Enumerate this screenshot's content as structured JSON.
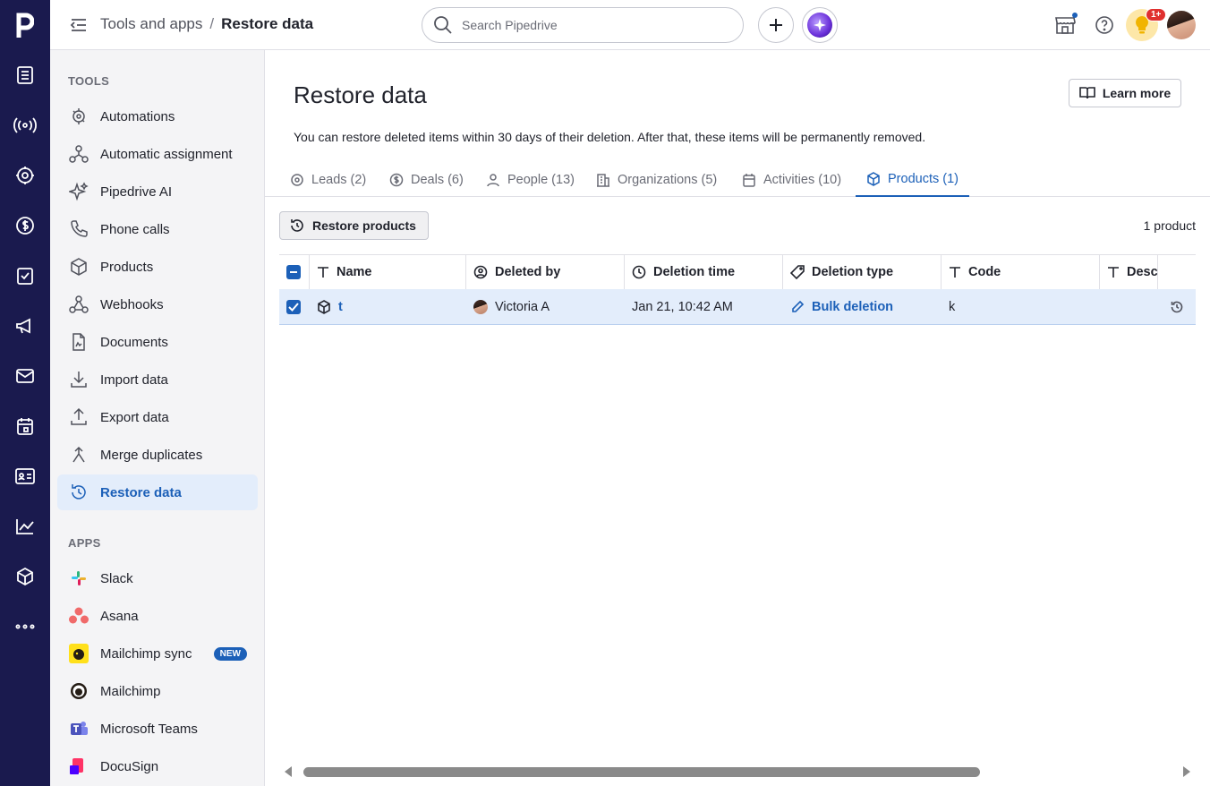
{
  "breadcrumb": {
    "parent": "Tools and apps",
    "separator": "/",
    "current": "Restore data"
  },
  "search": {
    "placeholder": "Search Pipedrive"
  },
  "notifications": {
    "badge": "1+"
  },
  "sidebar": {
    "tools_title": "TOOLS",
    "tools": [
      {
        "label": "Automations",
        "icon": "automations-icon"
      },
      {
        "label": "Automatic assignment",
        "icon": "assignment-icon"
      },
      {
        "label": "Pipedrive AI",
        "icon": "sparkle-icon"
      },
      {
        "label": "Phone calls",
        "icon": "phone-icon"
      },
      {
        "label": "Products",
        "icon": "box-icon"
      },
      {
        "label": "Webhooks",
        "icon": "webhook-icon"
      },
      {
        "label": "Documents",
        "icon": "document-icon"
      },
      {
        "label": "Import data",
        "icon": "import-icon"
      },
      {
        "label": "Export data",
        "icon": "export-icon"
      },
      {
        "label": "Merge duplicates",
        "icon": "merge-icon"
      },
      {
        "label": "Restore data",
        "icon": "restore-icon",
        "active": true
      }
    ],
    "apps_title": "APPS",
    "apps": [
      {
        "label": "Slack",
        "icon": "slack-icon"
      },
      {
        "label": "Asana",
        "icon": "asana-icon"
      },
      {
        "label": "Mailchimp sync",
        "icon": "mailchimp-icon",
        "badge": "NEW"
      },
      {
        "label": "Mailchimp",
        "icon": "mailchimp-icon"
      },
      {
        "label": "Microsoft Teams",
        "icon": "teams-icon"
      },
      {
        "label": "DocuSign",
        "icon": "docusign-icon"
      }
    ]
  },
  "main": {
    "title": "Restore data",
    "learn_more": "Learn more",
    "description": "You can restore deleted items within 30 days of their deletion. After that, these items will be permanently removed.",
    "tabs": [
      {
        "label": "Leads (2)"
      },
      {
        "label": "Deals (6)"
      },
      {
        "label": "People (13)"
      },
      {
        "label": "Organizations (5)"
      },
      {
        "label": "Activities (10)"
      },
      {
        "label": "Products (1)",
        "active": true
      }
    ],
    "restore_button": "Restore products",
    "count": "1 product"
  },
  "table": {
    "columns": [
      "Name",
      "Deleted by",
      "Deletion time",
      "Deletion type",
      "Code",
      "Desc"
    ],
    "rows": [
      {
        "name": "t",
        "deleted_by": "Victoria A",
        "deletion_time": "Jan 21, 10:42 AM",
        "deletion_type": "Bulk deletion",
        "code": "k",
        "desc": ""
      }
    ]
  },
  "colors": {
    "rail": "#1a1a4e",
    "accent": "#1c60b8",
    "selected_row": "#e3edfb"
  }
}
